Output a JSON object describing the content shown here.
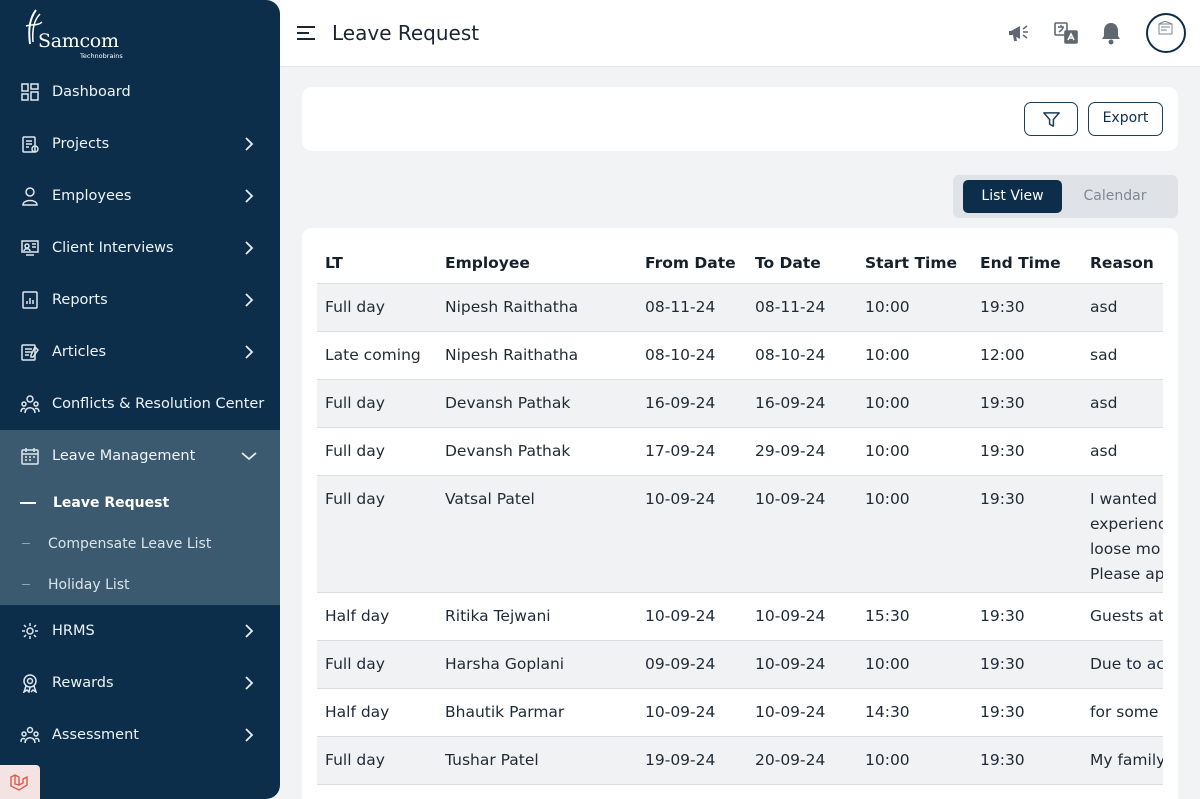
{
  "brand": {
    "name": "Samcom",
    "tagline": "Technobrains"
  },
  "sidebar": {
    "items": [
      {
        "label": "Dashboard",
        "icon": "dashboard-grid-icon"
      },
      {
        "label": "Projects",
        "icon": "clipboard-icon"
      },
      {
        "label": "Employees",
        "icon": "user-icon"
      },
      {
        "label": "Client Interviews",
        "icon": "presentation-icon"
      },
      {
        "label": "Reports",
        "icon": "report-icon"
      },
      {
        "label": "Articles",
        "icon": "article-icon"
      },
      {
        "label": "Conflicts & Resolution Center",
        "icon": "people-icon"
      },
      {
        "label": "Leave Management",
        "icon": "calendar-icon"
      },
      {
        "label": "HRMS",
        "icon": "hrms-icon"
      },
      {
        "label": "Rewards",
        "icon": "reward-icon"
      },
      {
        "label": "Assessment",
        "icon": "assessment-icon"
      }
    ],
    "leave_sub": [
      {
        "label": "Leave Request",
        "active": true
      },
      {
        "label": "Compensate Leave List",
        "active": false
      },
      {
        "label": "Holiday List",
        "active": false
      }
    ]
  },
  "header": {
    "title": "Leave Request"
  },
  "toolbar": {
    "export_label": "Export"
  },
  "view_toggle": {
    "list": "List View",
    "calendar": "Calendar",
    "selected": "List View"
  },
  "table": {
    "columns": [
      "LT",
      "Employee",
      "From Date",
      "To Date",
      "Start Time",
      "End Time",
      "Reason"
    ],
    "rows": [
      {
        "lt": "Full day",
        "employee": "Nipesh Raithatha",
        "from": "08-11-24",
        "to": "08-11-24",
        "start": "10:00",
        "end": "19:30",
        "reason": "asd"
      },
      {
        "lt": "Late coming",
        "employee": "Nipesh Raithatha",
        "from": "08-10-24",
        "to": "08-10-24",
        "start": "10:00",
        "end": "12:00",
        "reason": "sad"
      },
      {
        "lt": "Full day",
        "employee": "Devansh Pathak",
        "from": "16-09-24",
        "to": "16-09-24",
        "start": "10:00",
        "end": "19:30",
        "reason": "asd"
      },
      {
        "lt": "Full day",
        "employee": "Devansh Pathak",
        "from": "17-09-24",
        "to": "29-09-24",
        "start": "10:00",
        "end": "19:30",
        "reason": "asd"
      },
      {
        "lt": "Full day",
        "employee": "Vatsal Patel",
        "from": "10-09-24",
        "to": "10-09-24",
        "start": "10:00",
        "end": "19:30",
        "reason": "I wanted experienc loose mo Please ap"
      },
      {
        "lt": "Half day",
        "employee": "Ritika Tejwani",
        "from": "10-09-24",
        "to": "10-09-24",
        "start": "15:30",
        "end": "19:30",
        "reason": "Guests at"
      },
      {
        "lt": "Full day",
        "employee": "Harsha Goplani",
        "from": "09-09-24",
        "to": "10-09-24",
        "start": "10:00",
        "end": "19:30",
        "reason": "Due to ac"
      },
      {
        "lt": "Half day",
        "employee": "Bhautik Parmar",
        "from": "10-09-24",
        "to": "10-09-24",
        "start": "14:30",
        "end": "19:30",
        "reason": "for some"
      },
      {
        "lt": "Full day",
        "employee": "Tushar Patel",
        "from": "19-09-24",
        "to": "20-09-24",
        "start": "10:00",
        "end": "19:30",
        "reason": "My family"
      }
    ]
  },
  "colors": {
    "sidebar": "#0c2e4a",
    "submenu": "#3b5a70",
    "accent": "#0c2e4a",
    "row_stripe": "#f0f2f4"
  }
}
